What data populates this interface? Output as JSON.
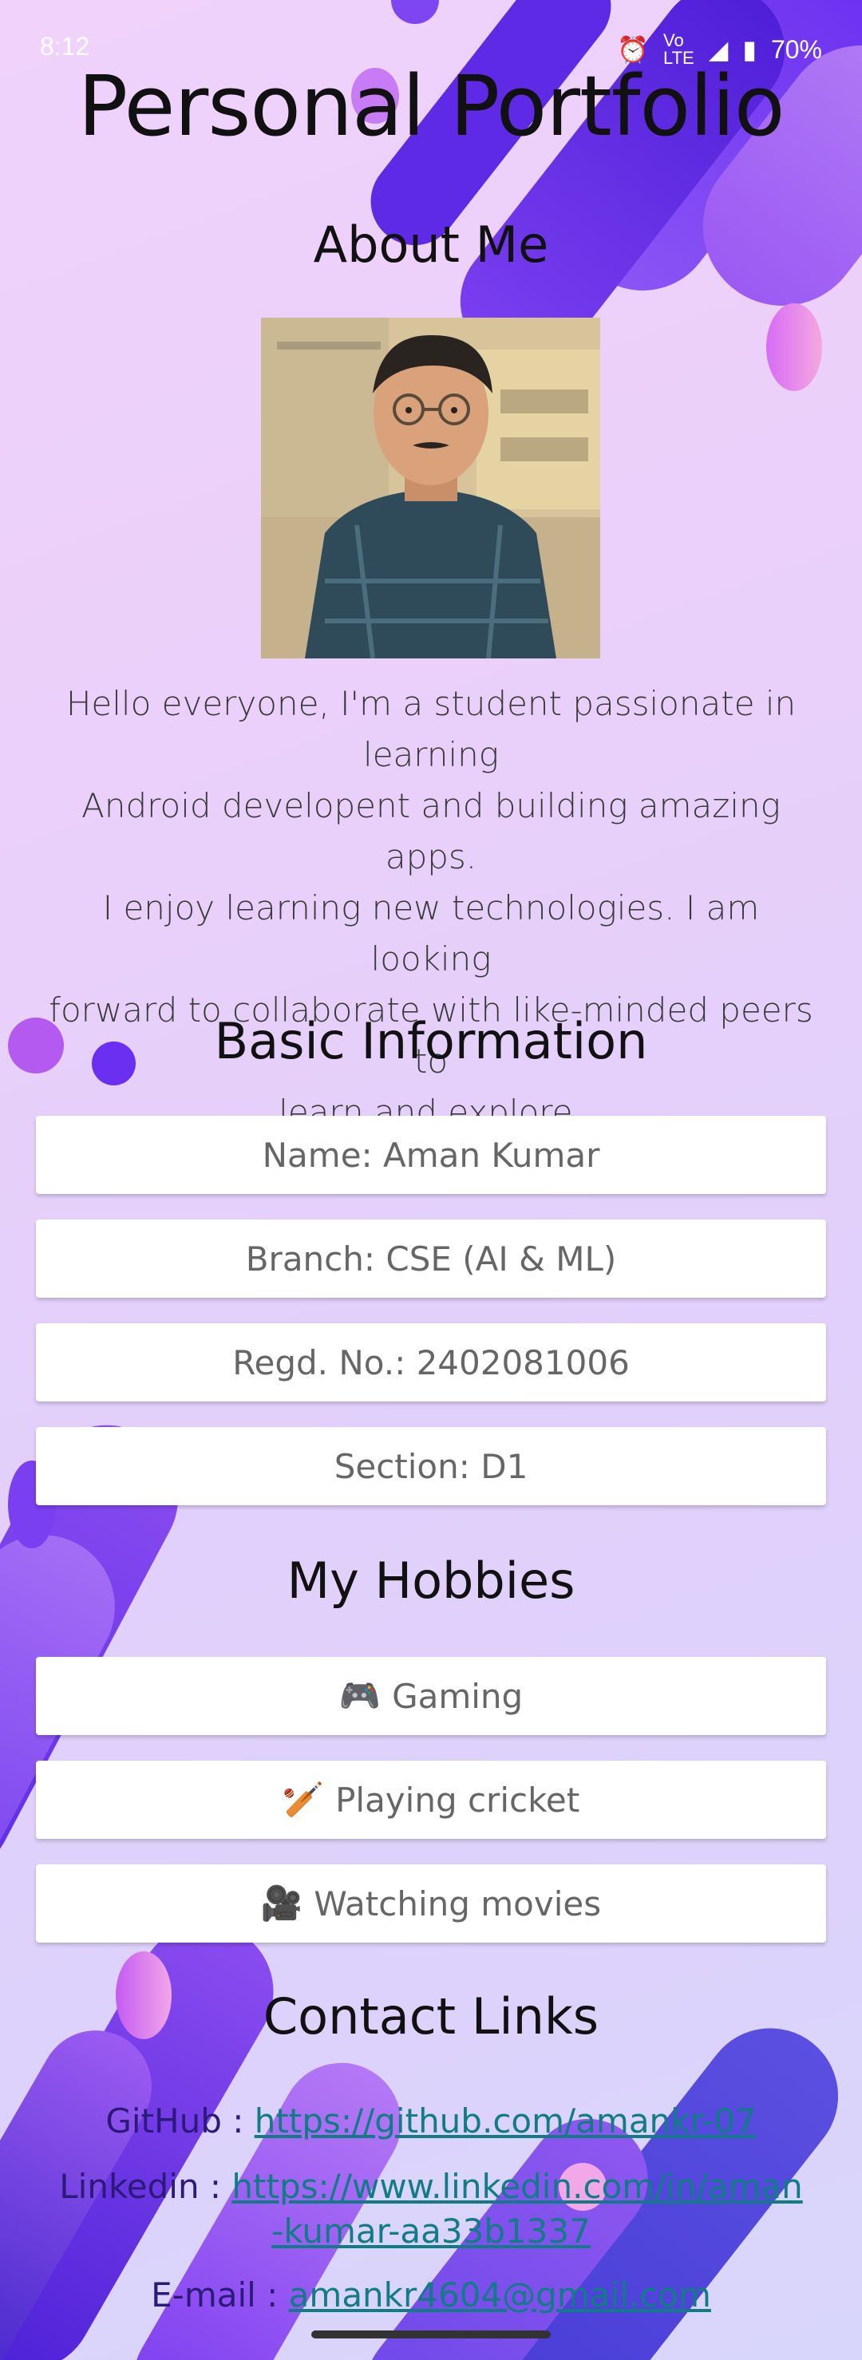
{
  "status_bar": {
    "time": "8:12",
    "battery": "70%",
    "icons": [
      "alarm-icon",
      "volte-icon",
      "signal-icon",
      "battery-icon"
    ]
  },
  "page": {
    "title": "Personal Portfolio",
    "about_heading": "About Me",
    "about_text_lines": [
      "Hello everyone, I'm a student passionate in learning",
      "Android developent and building amazing apps.",
      "I enjoy learning new technologies. I am looking",
      "forward to collaborate with like-minded peers to",
      "learn and explore."
    ],
    "basic_info_heading": "Basic Information",
    "basic_info": [
      "Name: Aman Kumar",
      "Branch: CSE (AI & ML)",
      "Regd. No.: 2402081006",
      "Section: D1"
    ],
    "hobbies_heading": "My Hobbies",
    "hobbies": [
      {
        "emoji": "🎮",
        "label": "Gaming"
      },
      {
        "emoji": "🏏",
        "label": "Playing cricket"
      },
      {
        "emoji": "🎥",
        "label": "Watching movies"
      }
    ],
    "contact_heading": "Contact Links",
    "contacts": {
      "github_label": "GitHub : ",
      "github_url": "https://github.com/amankr-07",
      "linkedin_label": "Linkedin : ",
      "linkedin_url_line1": "https://www.linkedin.com/in/aman",
      "linkedin_url_line2": "-kumar-aa33b1337",
      "email_label": "E-mail : ",
      "email": "amankr4604@gmail.com"
    }
  },
  "colors": {
    "accent_purple": "#7b3cf0",
    "link_teal": "#0f7c86",
    "label_navy": "#2c1a7a"
  }
}
